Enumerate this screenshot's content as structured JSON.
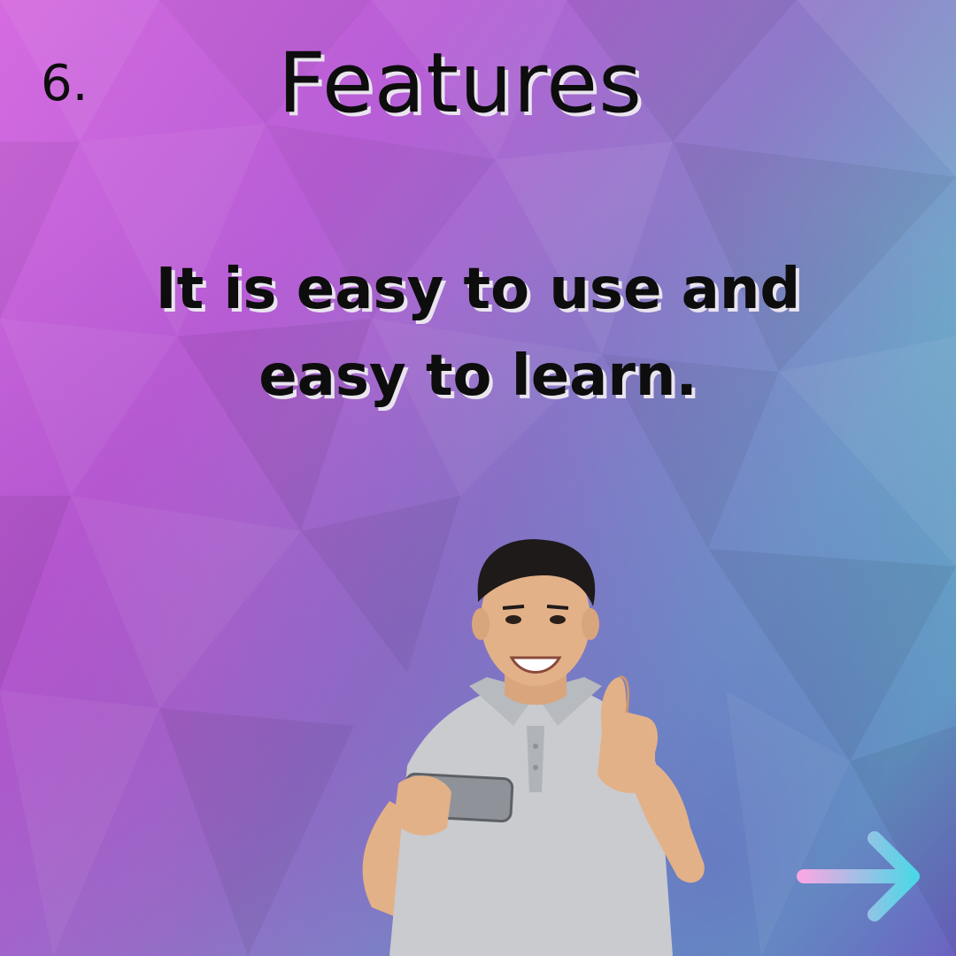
{
  "slide": {
    "number": "6.",
    "title": "Features",
    "body_line1": "It is easy to use and",
    "body_line2": "easy to learn."
  },
  "colors": {
    "text": "#0d0d0d",
    "text_shadow": "#e9e4ee",
    "bg_pink": "#d56be0",
    "bg_teal": "#5fb6c6",
    "bg_purple": "#6c69c2",
    "arrow_start": "#f6a8e4",
    "arrow_end": "#4fd6e6"
  },
  "icons": {
    "next": "arrow-right-icon"
  }
}
